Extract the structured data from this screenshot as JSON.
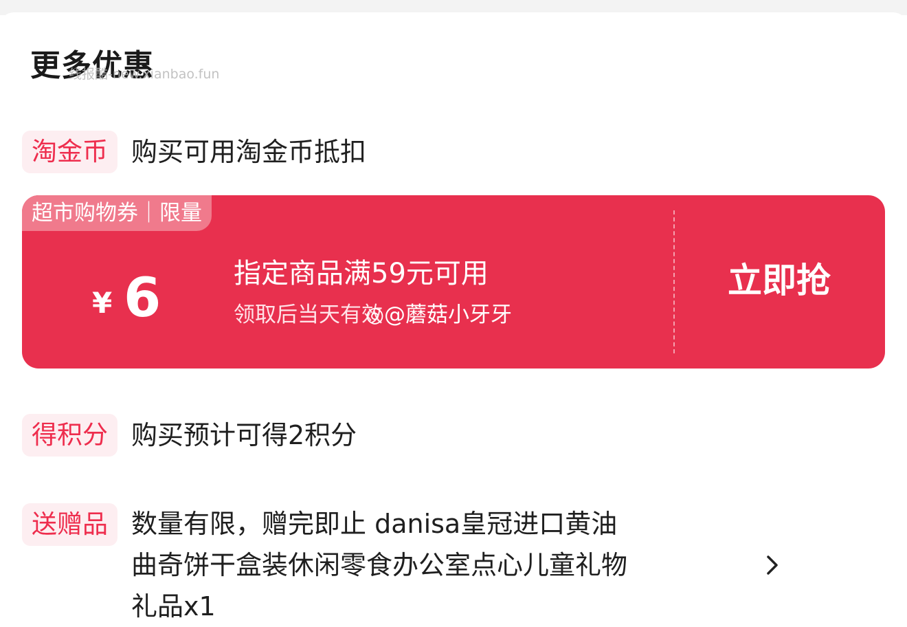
{
  "section": {
    "title": "更多优惠",
    "watermark": "线报酷-new.xianbao.fun"
  },
  "rows": {
    "coin": {
      "tag": "淘金币",
      "text": "购买可用淘金币抵扣"
    },
    "points": {
      "tag": "得积分",
      "text": "购买预计可得2积分"
    },
    "gift": {
      "tag": "送赠品",
      "line1": "数量有限，赠完即止 danisa皇冠进口黄油",
      "line2": "曲奇饼干盒装休闲零食办公室点心儿童礼物",
      "line3": "礼品x1"
    }
  },
  "coupon": {
    "tag": "超市购物券｜限量",
    "currency": "¥",
    "amount": "6",
    "condition": "指定商品满59元可用",
    "validity": "领取后当天有效",
    "weibo_watermark": "◎@蘑菇小牙牙",
    "button": "立即抢",
    "color": "#e8304e"
  },
  "icons": {
    "chevron": "chevron-right-icon"
  }
}
